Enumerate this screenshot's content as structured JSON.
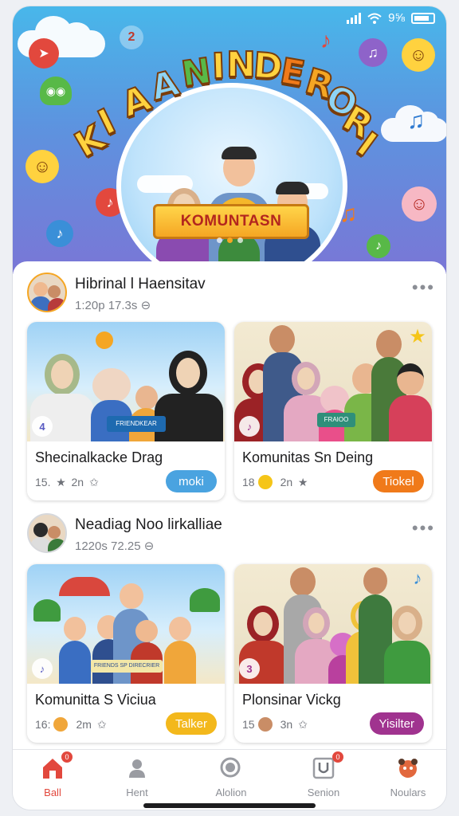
{
  "status_bar": {
    "battery": "9⅝"
  },
  "banner": {
    "title_letters": [
      "K",
      "I",
      "A",
      "A",
      "N",
      "I",
      "N",
      "D",
      "E",
      "R",
      "O",
      "R",
      "I"
    ],
    "ribbon": "KOMUNTASN",
    "deco_number": "2"
  },
  "posts": [
    {
      "name": "Hibrinal l Haensitav",
      "meta": "1:20p 17.3s ⊖",
      "cards": [
        {
          "index": "4",
          "title": "Shecinalkacke Drag",
          "stat_a": "15.",
          "stat_b": "2n",
          "button": "moki",
          "button_color": "#4aa3e0",
          "banner_text": "FRIENDKEAR"
        },
        {
          "index": "♪",
          "title": "Komunitas Sn Deing",
          "stat_a": "18",
          "stat_b": "2n",
          "button": "Tiokel",
          "button_color": "#f07a1a",
          "banner_text": "FRAIOO"
        }
      ]
    },
    {
      "name": "Neadiag Noo lirkalliae",
      "meta": "1220s 72.25 ⊖",
      "cards": [
        {
          "index": "♪",
          "title": "Komunitta S Viciua",
          "stat_a": "16:",
          "stat_b": "2m",
          "button": "Talker",
          "button_color": "#f3b81c",
          "banner_text": "FRIENDS SP DIRECRIER"
        },
        {
          "index": "3",
          "title": "Plonsinar Vickg",
          "stat_a": "15",
          "stat_b": "3n",
          "button": "Yisilter",
          "button_color": "#a0338f",
          "banner_text": ""
        }
      ]
    }
  ],
  "nav": [
    {
      "label": "Ball",
      "icon": "home-icon",
      "badge": "0",
      "active": true
    },
    {
      "label": "Hent",
      "icon": "person-icon",
      "badge": "",
      "active": false
    },
    {
      "label": "Alolion",
      "icon": "search-icon",
      "badge": "",
      "active": false
    },
    {
      "label": "Senion",
      "icon": "u-box-icon",
      "badge": "0",
      "active": false
    },
    {
      "label": "Noulars",
      "icon": "mascot-icon",
      "badge": "",
      "active": false
    }
  ],
  "colors": {
    "accent": "#e2483d",
    "orange": "#f5a623",
    "sky": "#48b7ea"
  }
}
